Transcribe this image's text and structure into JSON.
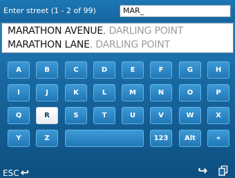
{
  "header": {
    "prompt": "Enter street (1 - 2 of 99)",
    "search_value": "MAR_"
  },
  "results": [
    {
      "street": "MARATHON AVENUE",
      "separator": ",",
      "suburb": "DARLING POINT"
    },
    {
      "street": "MARATHON LANE",
      "separator": ",",
      "suburb": "DARLING POINT"
    }
  ],
  "keyboard": {
    "row1": [
      "A",
      "B",
      "C",
      "D",
      "E",
      "F",
      "G",
      "H"
    ],
    "row2": [
      "I",
      "J",
      "K",
      "L",
      "M",
      "N",
      "O",
      "P"
    ],
    "row3": [
      "Q",
      "R",
      "S",
      "T",
      "U",
      "V",
      "W",
      "X"
    ],
    "row4": {
      "k1": "Y",
      "k2": "Z",
      "space": "",
      "numbers": "123",
      "alt": "Alt",
      "scroll": "«"
    },
    "highlighted_key": "R"
  },
  "bottom": {
    "esc_label": "ESC",
    "esc_icon": "back-arrow-icon",
    "go_icon": "forward-arrow-icon",
    "view_icon": "view-toggle-icon"
  },
  "colors": {
    "background": "#1868a1",
    "key": "#2d88c6",
    "key_active": "#ffffff",
    "suburb_text": "#9a9a9a"
  }
}
